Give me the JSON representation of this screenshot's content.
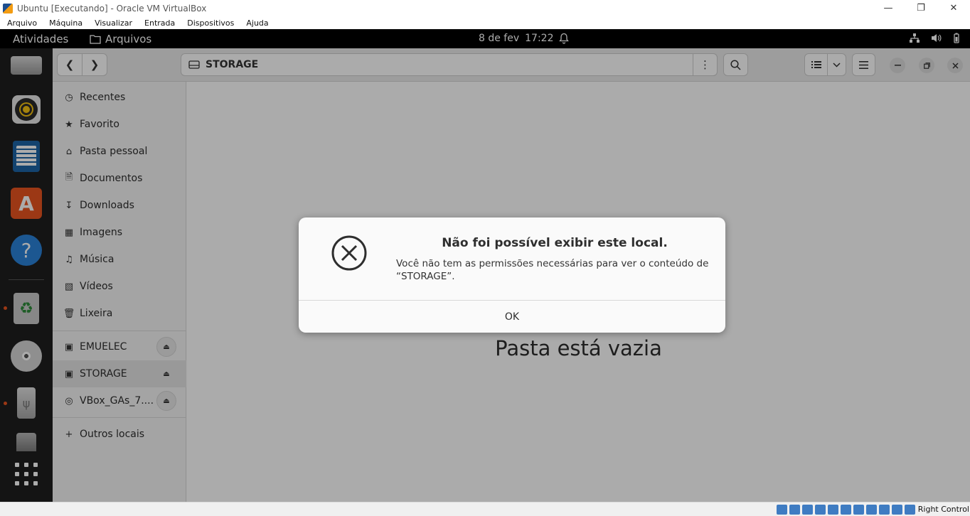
{
  "host": {
    "window_title": "Ubuntu [Executando] - Oracle VM VirtualBox",
    "menu": [
      "Arquivo",
      "Máquina",
      "Visualizar",
      "Entrada",
      "Dispositivos",
      "Ajuda"
    ],
    "host_key": "Right Control"
  },
  "topbar": {
    "activities": "Atividades",
    "app_name": "Arquivos",
    "date": "8 de fev",
    "time": "17:22"
  },
  "dock": {
    "icons": [
      "drive-icon",
      "rhythmbox-icon",
      "libreoffice-writer-icon",
      "ubuntu-software-icon",
      "help-icon",
      "trash-icon",
      "cd-drive-icon",
      "usb-drive-icon",
      "drive-icon",
      "show-apps-icon"
    ]
  },
  "nautilus": {
    "location": "STORAGE",
    "sidebar": {
      "places": [
        {
          "label": "Recentes",
          "icon": "clock-icon"
        },
        {
          "label": "Favorito",
          "icon": "star-icon"
        },
        {
          "label": "Pasta pessoal",
          "icon": "home-icon"
        },
        {
          "label": "Documentos",
          "icon": "document-icon"
        },
        {
          "label": "Downloads",
          "icon": "download-icon"
        },
        {
          "label": "Imagens",
          "icon": "image-icon"
        },
        {
          "label": "Música",
          "icon": "music-icon"
        },
        {
          "label": "Vídeos",
          "icon": "video-icon"
        },
        {
          "label": "Lixeira",
          "icon": "trash-icon"
        }
      ],
      "devices": [
        {
          "label": "EMUELEC"
        },
        {
          "label": "STORAGE"
        },
        {
          "label": "VBox_GAs_7...."
        }
      ],
      "other": "Outros locais"
    },
    "empty_message": "Pasta está vazia"
  },
  "dialog": {
    "title": "Não foi possível exibir este local.",
    "message": "Você não tem as permissões necessárias para ver o conteúdo de “STORAGE”.",
    "ok_label": "OK"
  }
}
